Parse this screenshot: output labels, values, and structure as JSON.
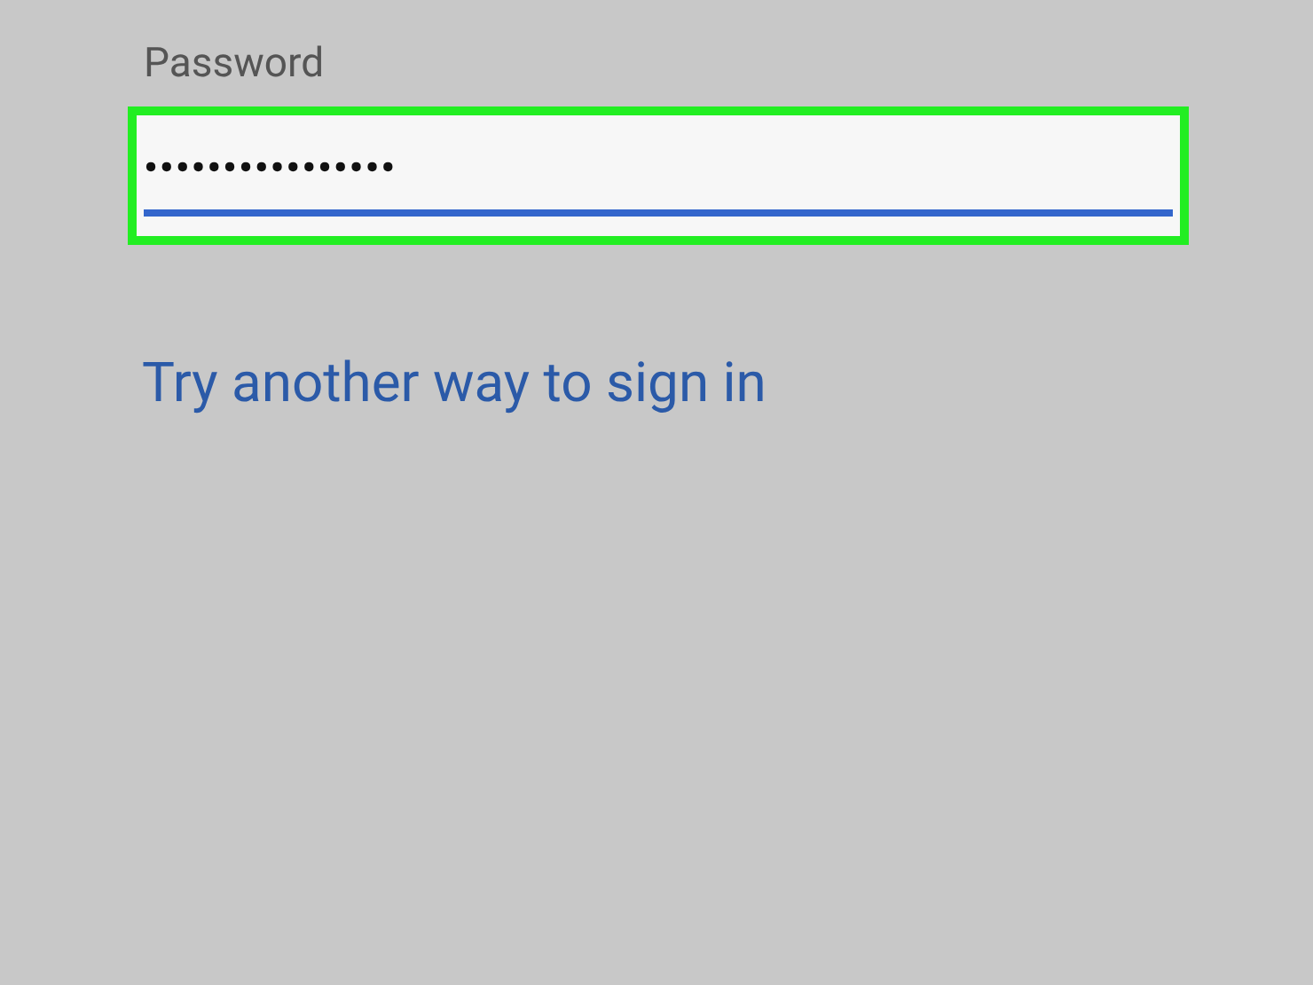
{
  "password_field": {
    "label": "Password",
    "value": "••••••••••••••••",
    "focused": true
  },
  "link": "Try another way to sign in"
}
